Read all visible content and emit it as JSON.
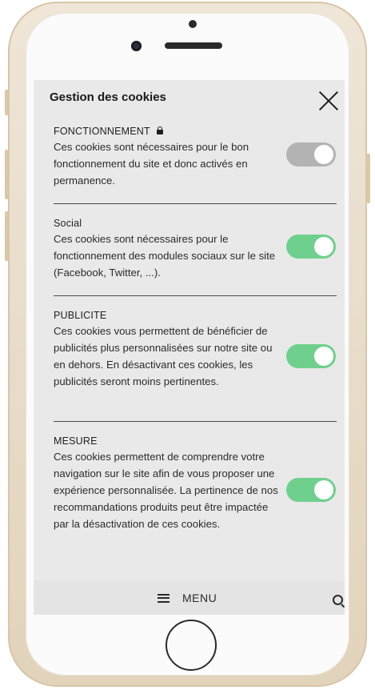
{
  "header": {
    "title": "Gestion des cookies"
  },
  "sections": [
    {
      "title": "FONCTIONNEMENT",
      "locked": true,
      "toggle": "off",
      "description": "Ces cookies sont nécessaires pour le bon fonctionnement du site et donc activés en permanence."
    },
    {
      "title": "Social",
      "locked": false,
      "toggle": "on",
      "description": "Ces cookies sont nécessaires pour le fonctionnement des modules sociaux sur le site (Facebook, Twitter, ...)."
    },
    {
      "title": "PUBLICITE",
      "locked": false,
      "toggle": "on",
      "description": "Ces cookies vous permettent de bénéficier de publicités plus personnalisées sur notre site ou en dehors. En désactivant ces cookies, les publicités seront moins pertinentes."
    },
    {
      "title": "MESURE",
      "locked": false,
      "toggle": "on",
      "description": "Ces cookies permettent de comprendre votre navigation sur le site afin de vous proposer une expérience personnalisée. La pertinence de nos recommandations produits peut être impactée par la désactivation de ces cookies."
    }
  ],
  "bottom_bar": {
    "menu_label": "MENU",
    "menu_icon": "hamburger-icon",
    "search_icon": "search-icon"
  },
  "colors": {
    "toggle_on": "#6fd08d",
    "toggle_off": "#b3b3b3",
    "screen_bg": "#e9e9e9",
    "phone_frame": "#e8dcc8"
  }
}
